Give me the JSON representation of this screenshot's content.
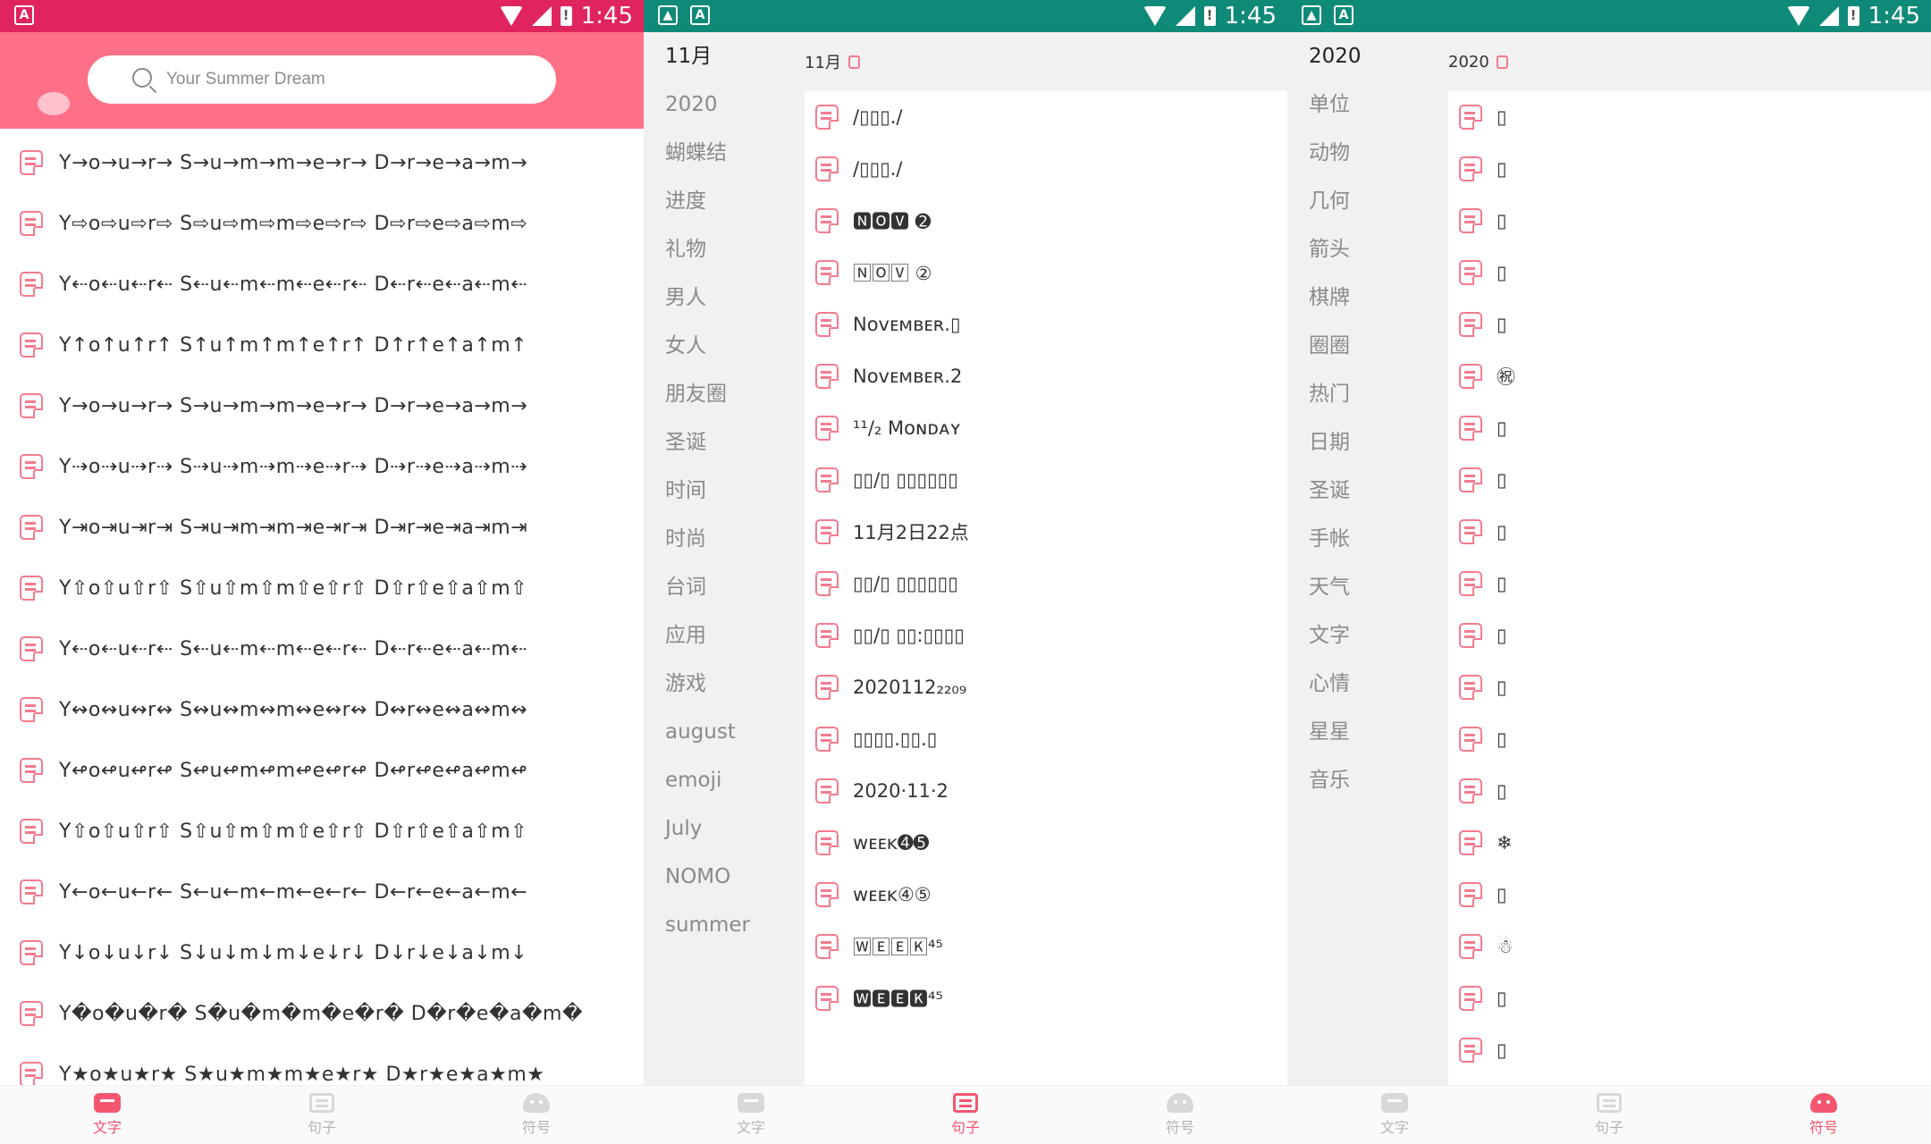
{
  "status_bar": {
    "time": "1:45"
  },
  "panels": [
    {
      "search": {
        "value": "",
        "placeholder": "Your Summer Dream"
      },
      "rows": [
        "Y→o→u→r→ S→u→m→m→e→r→ D→r→e→a→m→",
        "Y⇨o⇨u⇨r⇨ S⇨u⇨m⇨m⇨e⇨r⇨ D⇨r⇨e⇨a⇨m⇨",
        "Y⇠o⇠u⇠r⇠ S⇠u⇠m⇠m⇠e⇠r⇠ D⇠r⇠e⇠a⇠m⇠",
        "Y↑o↑u↑r↑ S↑u↑m↑m↑e↑r↑ D↑r↑e↑a↑m↑",
        "Y→o→u→r→ S→u→m→m→e→r→ D→r→e→a→m→",
        "Y⇢o⇢u⇢r⇢ S⇢u⇢m⇢m⇢e⇢r⇢ D⇢r⇢e⇢a⇢m⇢",
        "Y⇥o⇥u⇥r⇥ S⇥u⇥m⇥m⇥e⇥r⇥ D⇥r⇥e⇥a⇥m⇥",
        "Y⇧o⇧u⇧r⇧ S⇧u⇧m⇧m⇧e⇧r⇧ D⇧r⇧e⇧a⇧m⇧",
        "Y⇠o⇠u⇠r⇠ S⇠u⇠m⇠m⇠e⇠r⇠ D⇠r⇠e⇠a⇠m⇠",
        "Y↭o↭u↭r↭ S↭u↭m↭m↭e↭r↭ D↭r↭e↭a↭m↭",
        "Y↫o↫u↫r↫ S↫u↫m↫m↫e↫r↫ D↫r↫e↫a↫m↫",
        "Y⇧o⇧u⇧r⇧ S⇧u⇧m⇧m⇧e⇧r⇧ D⇧r⇧e⇧a⇧m⇧",
        "Y←o←u←r← S←u←m←m←e←r← D←r←e←a←m←",
        "Y↓o↓u↓r↓ S↓u↓m↓m↓e↓r↓ D↓r↓e↓a↓m↓",
        "Y�o�u�r� S�u�m�m�e�r� D�r�e�a�m�",
        "Y★o★u★r★ S★u★m★m★e★r★ D★r★e★a★m★"
      ],
      "nav": [
        {
          "label": "文字",
          "active": true
        },
        {
          "label": "句子",
          "active": false
        },
        {
          "label": "符号",
          "active": false
        }
      ]
    },
    {
      "categories": [
        "11月",
        "2020",
        "蝴蝶结",
        "进度",
        "礼物",
        "男人",
        "女人",
        "朋友圈",
        "圣诞",
        "时间",
        "时尚",
        "台词",
        "应用",
        "游戏",
        "august",
        "emoji",
        "July",
        "NOMO",
        "summer"
      ],
      "top_label": "11月",
      "rows": [
        "/▯▯▯./",
        "/▯▯▯./",
        "🅽🅾🆅 ➋",
        "🄽🄾🅅 ②",
        "Nᴏᴠᴇᴍʙᴇʀ.▯",
        "Nᴏᴠᴇᴍʙᴇʀ.2",
        "¹¹/₂ Mᴏɴᴅᴀʏ",
        "▯▯/▯ ▯▯▯▯▯▯",
        "11月2日22点",
        "▯▯/▯ ▯▯▯▯▯▯",
        "▯▯/▯ ▯▯:▯▯▯▯",
        "2020112₂₂₀₉",
        "▯▯▯▯.▯▯.▯",
        "2020·11·2",
        "ᴡᴇᴇᴋ➍➎",
        "ᴡᴇᴇᴋ④⑤",
        "🅆🄴🄴🄺⁴⁵",
        "🆆🅴🅴🅺⁴⁵"
      ],
      "nav": [
        {
          "label": "文字",
          "active": false
        },
        {
          "label": "句子",
          "active": true
        },
        {
          "label": "符号",
          "active": false
        }
      ]
    },
    {
      "categories": [
        "2020",
        "单位",
        "动物",
        "几何",
        "箭头",
        "棋牌",
        "圈圈",
        "热门",
        "日期",
        "圣诞",
        "手帐",
        "天气",
        "文字",
        "心情",
        "星星",
        "音乐"
      ],
      "top_label": "2020",
      "rows": [
        "▯",
        "▯",
        "▯",
        "▯",
        "▯",
        "㊗",
        "▯",
        "▯",
        "▯",
        "▯",
        "▯",
        "▯",
        "▯",
        "▯",
        "❄",
        "▯",
        "☃",
        "▯",
        "▯"
      ],
      "nav": [
        {
          "label": "文字",
          "active": false
        },
        {
          "label": "句子",
          "active": false
        },
        {
          "label": "符号",
          "active": true
        }
      ]
    }
  ]
}
